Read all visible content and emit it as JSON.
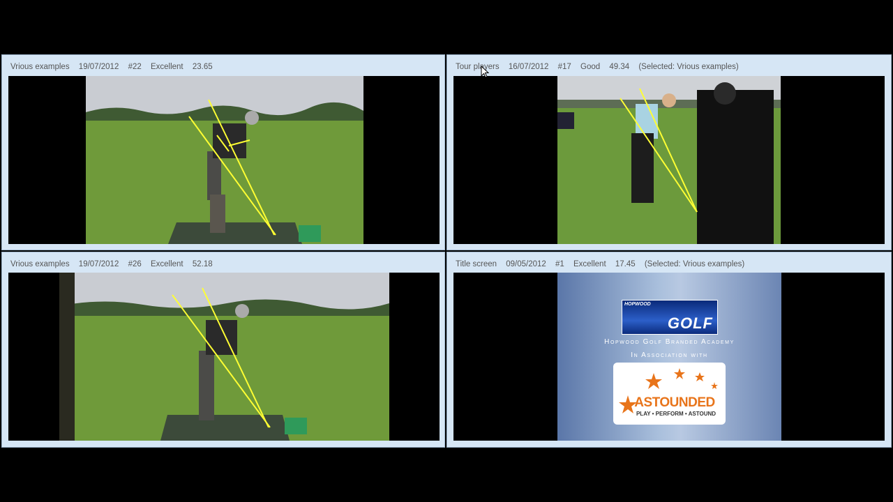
{
  "panes": [
    {
      "name": "Vrious examples",
      "date": "19/07/2012",
      "number": "#22",
      "rating": "Excellent",
      "score": "23.65",
      "selected": ""
    },
    {
      "name": "Tour players",
      "date": "16/07/2012",
      "number": "#17",
      "rating": "Good",
      "score": "49.34",
      "selected": "(Selected: Vrious examples)"
    },
    {
      "name": "Vrious examples",
      "date": "19/07/2012",
      "number": "#26",
      "rating": "Excellent",
      "score": "52.18",
      "selected": ""
    },
    {
      "name": "Title screen",
      "date": "09/05/2012",
      "number": "#1",
      "rating": "Excellent",
      "score": "17.45",
      "selected": "(Selected: Vrious examples)"
    }
  ],
  "title_card": {
    "logo_small": "HOPWOOD",
    "logo_big": "GOLF",
    "line1": "Hopwood Golf Branded Academy",
    "line2": "In Association with",
    "partner_name": "ASTOUNDED",
    "partner_tag": "PLAY • PERFORM • ASTOUND"
  },
  "colors": {
    "pane_bg": "#d6e6f5",
    "guide_lines": "#ffff33",
    "grass": "#6f9a3a",
    "sky": "#c9ccd2"
  }
}
